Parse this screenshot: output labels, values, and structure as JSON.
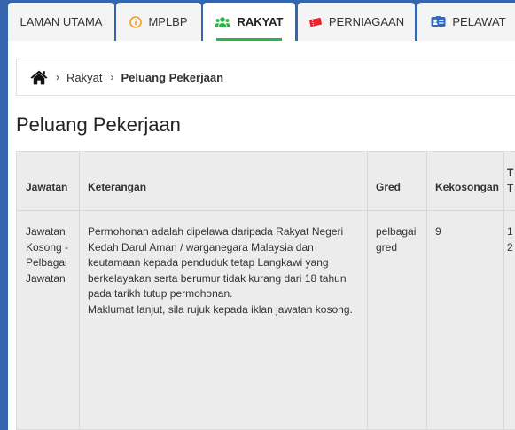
{
  "nav": {
    "tabs": [
      {
        "label": "LAMAN UTAMA",
        "icon": "none",
        "active": false
      },
      {
        "label": "MPLBP",
        "icon": "info-circle-icon",
        "active": false
      },
      {
        "label": "RAKYAT",
        "icon": "users-icon",
        "active": true
      },
      {
        "label": "PERNIAGAAN",
        "icon": "ticket-icon",
        "active": false
      },
      {
        "label": "PELAWAT",
        "icon": "id-card-icon",
        "active": false
      }
    ],
    "accent_color": "#2db34a",
    "bar_color": "#3566ad"
  },
  "breadcrumb": {
    "home_icon": "home-icon",
    "separator": "›",
    "items": [
      "Rakyat",
      "Peluang Pekerjaan"
    ]
  },
  "page": {
    "title": "Peluang Pekerjaan"
  },
  "table": {
    "headers": [
      "Jawatan",
      "Keterangan",
      "Gred",
      "Kekosongan",
      "T",
      "T"
    ],
    "rows": [
      {
        "jawatan": "Jawatan Kosong - Pelbagai Jawatan",
        "keterangan_1": "Permohonan adalah dipelawa daripada Rakyat Negeri Kedah Darul Aman / warganegara Malaysia dan keutamaan kepada penduduk tetap Langkawi yang berkelayakan serta berumur tidak kurang dari 18 tahun pada tarikh tutup permohonan.",
        "keterangan_2": "Maklumat lanjut, sila rujuk kepada iklan jawatan kosong.",
        "gred": "pelbagai gred",
        "kekosongan": "9",
        "extra_1": "1",
        "extra_2": "2"
      }
    ]
  }
}
